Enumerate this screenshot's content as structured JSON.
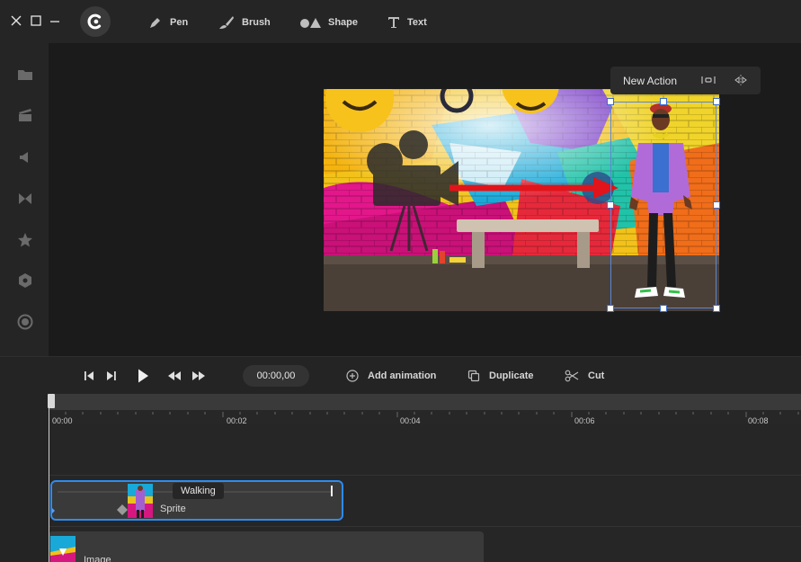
{
  "window": {
    "controls": [
      {
        "name": "close-icon"
      },
      {
        "name": "maximize-icon"
      },
      {
        "name": "minimize-icon"
      }
    ]
  },
  "toolbar": {
    "tools": [
      {
        "label": "Pen",
        "icon": "pen-icon"
      },
      {
        "label": "Brush",
        "icon": "brush-icon"
      },
      {
        "label": "Shape",
        "icon": "shape-icon"
      },
      {
        "label": "Text",
        "icon": "text-icon"
      }
    ]
  },
  "sidebar": {
    "items": [
      {
        "icon": "folder-icon"
      },
      {
        "icon": "clapperboard-icon"
      },
      {
        "icon": "speaker-icon"
      },
      {
        "icon": "transition-icon"
      },
      {
        "icon": "star-icon"
      },
      {
        "icon": "hexagon-icon"
      },
      {
        "icon": "record-icon"
      }
    ]
  },
  "action_popup": {
    "label": "New Action",
    "icons": [
      "align-center-icon",
      "flip-horizontal-icon"
    ]
  },
  "transport": {
    "buttons": [
      "skip-to-start-icon",
      "step-forward-icon",
      "play-icon",
      "rewind-icon",
      "fast-forward-icon"
    ],
    "time": "00:00,00",
    "actions": [
      {
        "label": "Add animation",
        "icon": "add-circle-icon"
      },
      {
        "label": "Duplicate",
        "icon": "duplicate-icon"
      },
      {
        "label": "Cut",
        "icon": "scissors-icon"
      }
    ]
  },
  "timeline": {
    "ticks": [
      "00:00",
      "00:02",
      "00:04",
      "00:06",
      "00:08"
    ],
    "tracks": [
      {
        "name": "Sprite",
        "tag": "Walking"
      },
      {
        "name": "Image"
      }
    ]
  },
  "colors": {
    "accent": "#2d8bf0",
    "selection": "#5a86d6",
    "arrow": "#e0141a"
  }
}
